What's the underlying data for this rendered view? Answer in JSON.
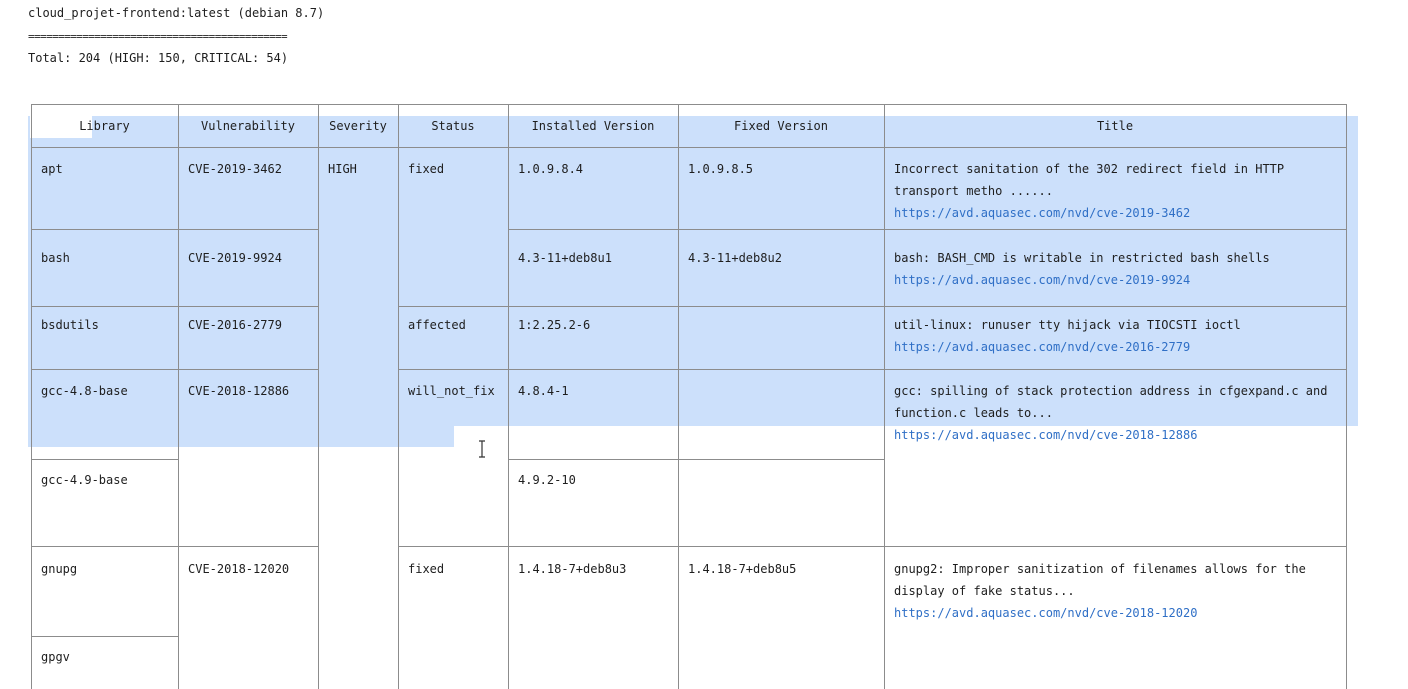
{
  "header": {
    "image_line": "cloud_projet-frontend:latest (debian 8.7)",
    "rule_line": "===========================================",
    "total_line": "Total: 204 (HIGH: 150, CRITICAL: 54)"
  },
  "table": {
    "columns": [
      "Library",
      "Vulnerability",
      "Severity",
      "Status",
      "Installed Version",
      "Fixed Version",
      "Title"
    ],
    "rows": [
      {
        "library": "apt",
        "vulnerability": "CVE-2019-3462",
        "severity": "HIGH",
        "status": "fixed",
        "installed": "1.0.9.8.4",
        "fixed": "1.0.9.8.5",
        "title_lines": [
          "Incorrect sanitation of the 302 redirect field in HTTP",
          "transport metho ......"
        ],
        "link": "https://avd.aquasec.com/nvd/cve-2019-3462"
      },
      {
        "library": "bash",
        "vulnerability": "CVE-2019-9924",
        "severity": "",
        "status": "",
        "installed": "4.3-11+deb8u1",
        "fixed": "4.3-11+deb8u2",
        "title_lines": [
          "bash: BASH_CMD is writable in restricted bash shells"
        ],
        "link": "https://avd.aquasec.com/nvd/cve-2019-9924"
      },
      {
        "library": "bsdutils",
        "vulnerability": "CVE-2016-2779",
        "severity": "",
        "status": "affected",
        "installed": "1:2.25.2-6",
        "fixed": "",
        "title_lines": [
          "util-linux: runuser tty hijack via TIOCSTI ioctl"
        ],
        "link": "https://avd.aquasec.com/nvd/cve-2016-2779"
      },
      {
        "library": "gcc-4.8-base",
        "vulnerability": "CVE-2018-12886",
        "severity": "",
        "status": "will_not_fix",
        "installed": "4.8.4-1",
        "fixed": "",
        "title_lines": [
          "gcc: spilling of stack protection address in cfgexpand.c and",
          "function.c leads to..."
        ],
        "link": "https://avd.aquasec.com/nvd/cve-2018-12886"
      },
      {
        "library": "gcc-4.9-base",
        "vulnerability": "",
        "severity": "",
        "status": "",
        "installed": "4.9.2-10",
        "fixed": "",
        "title_lines": [],
        "link": ""
      },
      {
        "library": "gnupg",
        "vulnerability": "CVE-2018-12020",
        "severity": "",
        "status": "fixed",
        "installed": "1.4.18-7+deb8u3",
        "fixed": "1.4.18-7+deb8u5",
        "title_lines": [
          "gnupg2: Improper sanitization of filenames allows for the",
          "display of fake status..."
        ],
        "link": "https://avd.aquasec.com/nvd/cve-2018-12020"
      },
      {
        "library": "gpgv",
        "vulnerability": "",
        "severity": "",
        "status": "",
        "installed": "",
        "fixed": "",
        "title_lines": [],
        "link": ""
      }
    ]
  },
  "colors": {
    "selection": "#cce0fb",
    "link": "#2f6fc6",
    "text": "#1e1e1e",
    "border": "#8c8c8c"
  },
  "icons": {
    "cursor": "text-cursor-icon"
  }
}
